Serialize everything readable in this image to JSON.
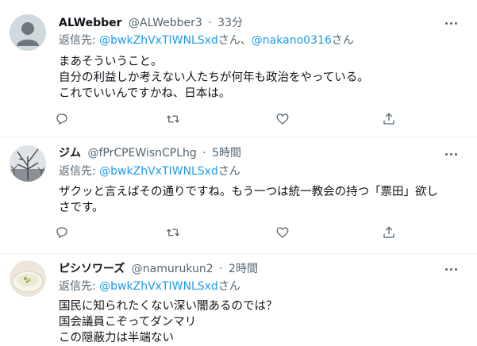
{
  "tweets": [
    {
      "name": "ALWebber",
      "handle": "@ALWebber3",
      "time": "33分",
      "reply_prefix": "返信先: ",
      "mention1": "@bwkZhVxTIWNLSxd",
      "sep1": "さん、",
      "mention2": "@nakano0316",
      "sep2": "さん",
      "lines": [
        "まあそういうこと。",
        "自分の利益しか考えない人たちが何年も政治をやっている。",
        "これでいいんですかね、日本は。"
      ],
      "avatar": "default-avatar"
    },
    {
      "name": "ジム",
      "handle": "@fPrCPEWisnCPLhg",
      "time": "5時間",
      "reply_prefix": "返信先: ",
      "mention1": "@bwkZhVxTIWNLSxd",
      "sep1": "さん",
      "lines": [
        "ザクッと言えばその通りですね。もう一つは統一教会の持つ「票田」欲し",
        "さです。"
      ],
      "avatar": "tree-photo-avatar"
    },
    {
      "name": "ピシソワーズ",
      "handle": "@namurukun2",
      "time": "2時間",
      "reply_prefix": "返信先: ",
      "mention1": "@bwkZhVxTIWNLSxd",
      "sep1": "さん",
      "lines": [
        "国民に知られたくない深い闇あるのでは？",
        "国会議員こぞってダンマリ",
        "この隠蔽力は半端ない"
      ],
      "avatar": "soup-photo-avatar"
    }
  ],
  "icons": [
    "reply-icon",
    "retweet-icon",
    "like-icon",
    "share-icon",
    "more-icon"
  ],
  "colors": {
    "text": "#0f1419",
    "secondary": "#536471",
    "link": "#1d9bf0",
    "divider": "#eff3f4"
  }
}
